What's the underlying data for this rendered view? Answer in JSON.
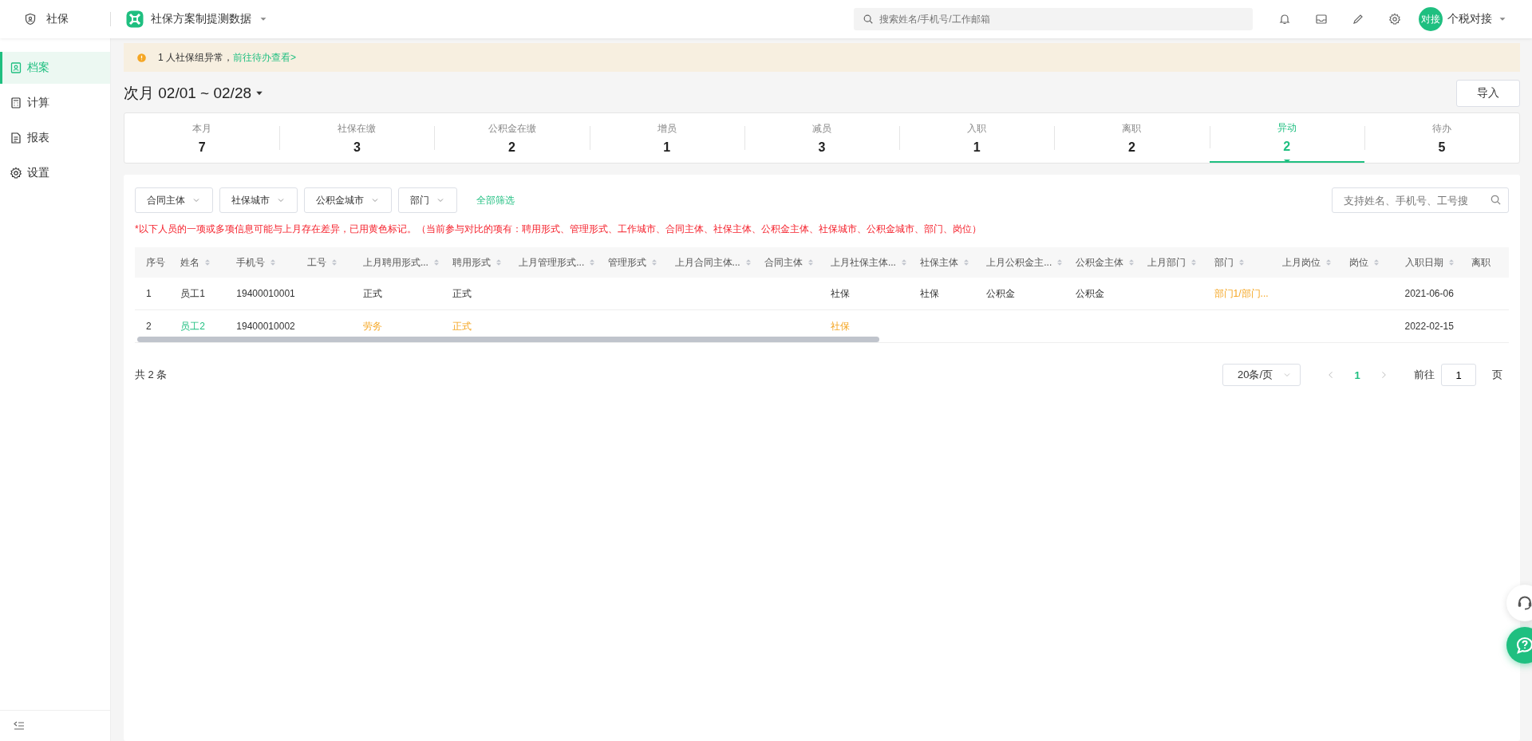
{
  "topbar": {
    "module": "社保",
    "project": "社保方案制提测数据",
    "search": {
      "placeholder": "搜索姓名/手机号/工作邮箱"
    },
    "avatar": "对接",
    "user": "个税对接"
  },
  "sidebar": {
    "items": [
      {
        "label": "档案",
        "selected": true
      },
      {
        "label": "计算",
        "selected": false
      },
      {
        "label": "报表",
        "selected": false
      },
      {
        "label": "设置",
        "selected": false
      }
    ]
  },
  "alert": {
    "text": "1 人社保组异常，",
    "link": "前往待办查看>"
  },
  "period": "次月 02/01 ~ 02/28",
  "import_button": "导入",
  "stats": [
    {
      "label": "本月",
      "value": "7",
      "selected": false
    },
    {
      "label": "社保在缴",
      "value": "3",
      "selected": false
    },
    {
      "label": "公积金在缴",
      "value": "2",
      "selected": false
    },
    {
      "label": "增员",
      "value": "1",
      "selected": false
    },
    {
      "label": "减员",
      "value": "3",
      "selected": false
    },
    {
      "label": "入职",
      "value": "1",
      "selected": false
    },
    {
      "label": "离职",
      "value": "2",
      "selected": false
    },
    {
      "label": "异动",
      "value": "2",
      "selected": true
    },
    {
      "label": "待办",
      "value": "5",
      "selected": false
    }
  ],
  "filters": [
    "合同主体",
    "社保城市",
    "公积金城市",
    "部门"
  ],
  "all_filters": "全部筛选",
  "table_search": {
    "placeholder": "支持姓名、手机号、工号搜"
  },
  "notice": "*以下人员的一项或多项信息可能与上月存在差异，已用黄色标记。（当前参与对比的项有：聘用形式、管理形式、工作城市、合同主体、社保主体、公积金主体、社保城市、公积金城市、部门、岗位）",
  "table": {
    "columns": [
      {
        "label": "序号",
        "sortable": false
      },
      {
        "label": "姓名",
        "sortable": true
      },
      {
        "label": "手机号",
        "sortable": true
      },
      {
        "label": "工号",
        "sortable": true
      },
      {
        "label": "上月聘用形式...",
        "sortable": true
      },
      {
        "label": "聘用形式",
        "sortable": true
      },
      {
        "label": "上月管理形式...",
        "sortable": true
      },
      {
        "label": "管理形式",
        "sortable": true
      },
      {
        "label": "上月合同主体...",
        "sortable": true
      },
      {
        "label": "合同主体",
        "sortable": true
      },
      {
        "label": "上月社保主体...",
        "sortable": true
      },
      {
        "label": "社保主体",
        "sortable": true
      },
      {
        "label": "上月公积金主...",
        "sortable": true
      },
      {
        "label": "公积金主体",
        "sortable": true
      },
      {
        "label": "上月部门",
        "sortable": true
      },
      {
        "label": "部门",
        "sortable": true
      },
      {
        "label": "上月岗位",
        "sortable": true
      },
      {
        "label": "岗位",
        "sortable": true
      },
      {
        "label": "入职日期",
        "sortable": true
      },
      {
        "label": "离职",
        "sortable": false
      }
    ],
    "rows": [
      {
        "cells": [
          {
            "text": "1",
            "kind": "plain"
          },
          {
            "text": "员工1",
            "kind": "plain"
          },
          {
            "text": "19400010001",
            "kind": "plain"
          },
          null,
          {
            "text": "正式",
            "kind": "plain"
          },
          {
            "text": "正式",
            "kind": "plain"
          },
          null,
          null,
          null,
          null,
          {
            "text": "社保",
            "kind": "plain"
          },
          {
            "text": "社保",
            "kind": "plain"
          },
          {
            "text": "公积金",
            "kind": "plain"
          },
          {
            "text": "公积金",
            "kind": "plain"
          },
          null,
          {
            "text": "部门1/部门...",
            "kind": "changed"
          },
          null,
          null,
          {
            "text": "2021-06-06",
            "kind": "plain"
          },
          null
        ]
      },
      {
        "cells": [
          {
            "text": "2",
            "kind": "plain"
          },
          {
            "text": "员工2",
            "kind": "link"
          },
          {
            "text": "19400010002",
            "kind": "plain"
          },
          null,
          {
            "text": "劳务",
            "kind": "changed"
          },
          {
            "text": "正式",
            "kind": "changed"
          },
          null,
          null,
          null,
          null,
          {
            "text": "社保",
            "kind": "changed"
          },
          null,
          null,
          null,
          null,
          null,
          null,
          null,
          {
            "text": "2022-02-15",
            "kind": "plain"
          },
          null
        ]
      }
    ]
  },
  "total": "共 2 条",
  "page_size": "20条/页",
  "pages": [
    {
      "label": "1",
      "selected": true
    }
  ],
  "goto_label": "前往",
  "goto_value": "1",
  "page_unit": "页"
}
